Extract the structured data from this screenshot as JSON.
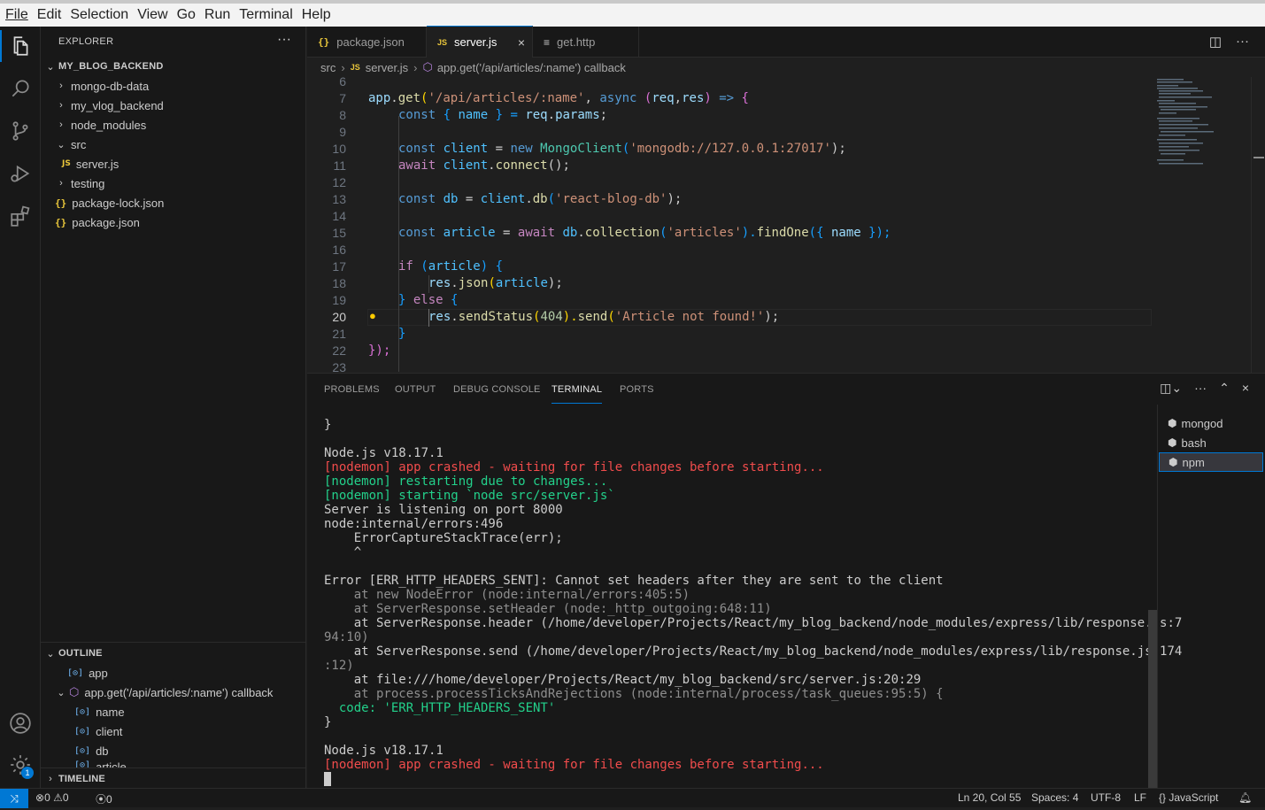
{
  "menu": [
    "File",
    "Edit",
    "Selection",
    "View",
    "Go",
    "Run",
    "Terminal",
    "Help"
  ],
  "explorer": {
    "title": "EXPLORER",
    "more": "···",
    "project": "MY_BLOG_BACKEND",
    "items": [
      {
        "label": "mongo-db-data",
        "chev": "›"
      },
      {
        "label": "my_vlog_backend",
        "chev": "›"
      },
      {
        "label": "node_modules",
        "chev": "›"
      },
      {
        "label": "src",
        "chev": "⌄"
      },
      {
        "label": "server.js",
        "icon": "JS"
      },
      {
        "label": "testing",
        "chev": "›"
      },
      {
        "label": "package-lock.json",
        "icon": "{}"
      },
      {
        "label": "package.json",
        "icon": "{}"
      }
    ]
  },
  "outline": {
    "title": "OUTLINE",
    "items": [
      "app",
      "app.get('/api/articles/:name') callback",
      "name",
      "client",
      "db",
      "article"
    ]
  },
  "timeline": {
    "title": "TIMELINE"
  },
  "tabs": [
    {
      "label": "package.json",
      "icon": "{}"
    },
    {
      "label": "server.js",
      "icon": "JS",
      "close": "×"
    },
    {
      "label": "get.http",
      "icon": "≡"
    }
  ],
  "breadcrumb": {
    "folder": "src",
    "file": "server.js",
    "symbol": "app.get('/api/articles/:name') callback"
  },
  "editor": {
    "line_numbers": [
      "6",
      "7",
      "8",
      "9",
      "10",
      "11",
      "12",
      "13",
      "14",
      "15",
      "16",
      "17",
      "18",
      "19",
      "20",
      "21",
      "22",
      "23"
    ],
    "current_line": "20",
    "code": {
      "l7": [
        "app",
        ".",
        "get",
        "(",
        "'/api/articles/:name'",
        ", ",
        "async",
        " (",
        "req",
        ",",
        "res",
        ") ",
        "=>",
        " {"
      ],
      "l8": [
        "const",
        " { ",
        "name",
        " } = ",
        "req",
        ".",
        "params",
        ";"
      ],
      "l10": [
        "const ",
        "client",
        " = ",
        "new ",
        "MongoClient",
        "(",
        "'mongodb://127.0.0.1:27017'",
        ");"
      ],
      "l11": [
        "await ",
        "client",
        ".",
        "connect",
        "();"
      ],
      "l13": [
        "const ",
        "db",
        " = ",
        "client",
        ".",
        "db",
        "(",
        "'react-blog-db'",
        ");"
      ],
      "l15": [
        "const ",
        "article",
        " = ",
        "await ",
        "db",
        ".",
        "collection",
        "(",
        "'articles'",
        ").",
        "findOne",
        "({ ",
        "name",
        " });"
      ],
      "l17": [
        "if",
        " (",
        "article",
        ") {"
      ],
      "l18": [
        "res",
        ".",
        "json",
        "(",
        "article",
        ");"
      ],
      "l19": [
        "}",
        " else",
        " {"
      ],
      "l20": [
        "res",
        ".",
        "sendStatus",
        "(",
        "404",
        ").",
        "send",
        "(",
        "'Article not found!'",
        ");"
      ],
      "l21": [
        "}"
      ],
      "l22": [
        "});"
      ]
    }
  },
  "panel": {
    "tabs": [
      "PROBLEMS",
      "OUTPUT",
      "DEBUG CONSOLE",
      "TERMINAL",
      "PORTS"
    ],
    "active_tab": "TERMINAL",
    "terminals": [
      "mongod",
      "bash",
      "npm"
    ],
    "selected_terminal": "npm",
    "lines": [
      {
        "t": "}",
        "c": ""
      },
      {
        "t": "",
        "c": ""
      },
      {
        "t": "Node.js v18.17.1",
        "c": ""
      },
      {
        "t": "[nodemon] app crashed - waiting for file changes before starting...",
        "c": "red"
      },
      {
        "t": "[nodemon] restarting due to changes...",
        "c": "grn"
      },
      {
        "t": "[nodemon] starting `node src/server.js`",
        "c": "grn"
      },
      {
        "t": "Server is listening on port 8000",
        "c": ""
      },
      {
        "t": "node:internal/errors:496",
        "c": ""
      },
      {
        "t": "    ErrorCaptureStackTrace(err);",
        "c": ""
      },
      {
        "t": "    ^",
        "c": ""
      },
      {
        "t": "",
        "c": ""
      },
      {
        "t": "Error [ERR_HTTP_HEADERS_SENT]: Cannot set headers after they are sent to the client",
        "c": ""
      },
      {
        "t": "    at new NodeError (node:internal/errors:405:5)",
        "c": "gray"
      },
      {
        "t": "    at ServerResponse.setHeader (node:_http_outgoing:648:11)",
        "c": "gray"
      },
      {
        "t": "    at ServerResponse.header (/home/developer/Projects/React/my_blog_backend/node_modules/express/lib/response.js:7",
        "c": "mix1"
      },
      {
        "t": "94:10)",
        "c": "gray"
      },
      {
        "t": "    at ServerResponse.send (/home/developer/Projects/React/my_blog_backend/node_modules/express/lib/response.js:174",
        "c": "mix2"
      },
      {
        "t": ":12)",
        "c": "gray"
      },
      {
        "t": "    at file:///home/developer/Projects/React/my_blog_backend/src/server.js:20:29",
        "c": "mix3"
      },
      {
        "t": "    at process.processTicksAndRejections (node:internal/process/task_queues:95:5) {",
        "c": "mix4"
      },
      {
        "t": "  code: 'ERR_HTTP_HEADERS_SENT'",
        "c": "code"
      },
      {
        "t": "}",
        "c": ""
      },
      {
        "t": "",
        "c": ""
      },
      {
        "t": "Node.js v18.17.1",
        "c": ""
      },
      {
        "t": "[nodemon] app crashed - waiting for file changes before starting...",
        "c": "red"
      }
    ]
  },
  "status": {
    "errors": "0",
    "warnings": "0",
    "ports": "0",
    "position": "Ln 20, Col 55",
    "spaces": "Spaces: 4",
    "encoding": "UTF-8",
    "eol": "LF",
    "language": "JavaScript",
    "settings_badge": "1"
  },
  "colors": {
    "accent": "#0078d4",
    "editor_bg": "#1f1f1f",
    "sidebar_bg": "#181818"
  }
}
